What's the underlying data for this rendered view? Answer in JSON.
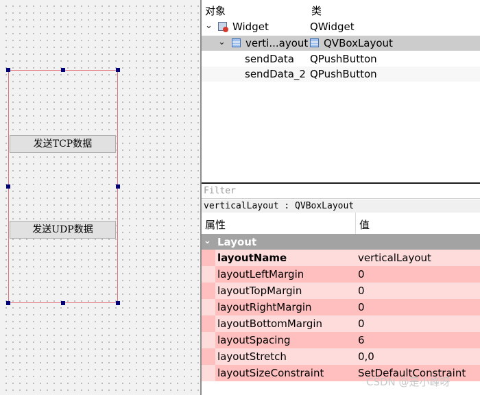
{
  "canvas": {
    "buttons": [
      "发送TCP数据",
      "发送UDP数据"
    ]
  },
  "object_inspector": {
    "headers": [
      "对象",
      "类"
    ],
    "rows": [
      {
        "name": "Widget",
        "class": "QWidget"
      },
      {
        "name": "verti...ayout",
        "class": "QVBoxLayout"
      },
      {
        "name": "sendData",
        "class": "QPushButton"
      },
      {
        "name": "sendData_2",
        "class": "QPushButton"
      }
    ]
  },
  "property_editor": {
    "filter_placeholder": "Filter",
    "object_label": "verticalLayout : QVBoxLayout",
    "headers": [
      "属性",
      "值"
    ],
    "group": "Layout",
    "rows": [
      {
        "key": "layoutName",
        "value": "verticalLayout"
      },
      {
        "key": "layoutLeftMargin",
        "value": "0"
      },
      {
        "key": "layoutTopMargin",
        "value": "0"
      },
      {
        "key": "layoutRightMargin",
        "value": "0"
      },
      {
        "key": "layoutBottomMargin",
        "value": "0"
      },
      {
        "key": "layoutSpacing",
        "value": "6"
      },
      {
        "key": "layoutStretch",
        "value": "0,0"
      },
      {
        "key": "layoutSizeConstraint",
        "value": "SetDefaultConstraint"
      }
    ]
  },
  "watermark": "CSDN @是小峰呀",
  "icons": [
    "widget-icon",
    "layout-icon",
    "chevron-down-icon"
  ],
  "colors": {
    "row_light": "#ffdcdc",
    "row_dark": "#ffbfbf",
    "selection": "#cccccc",
    "group_header": "#a3a3a3",
    "layout_frame": "#e0707a",
    "handle": "#00007f"
  }
}
